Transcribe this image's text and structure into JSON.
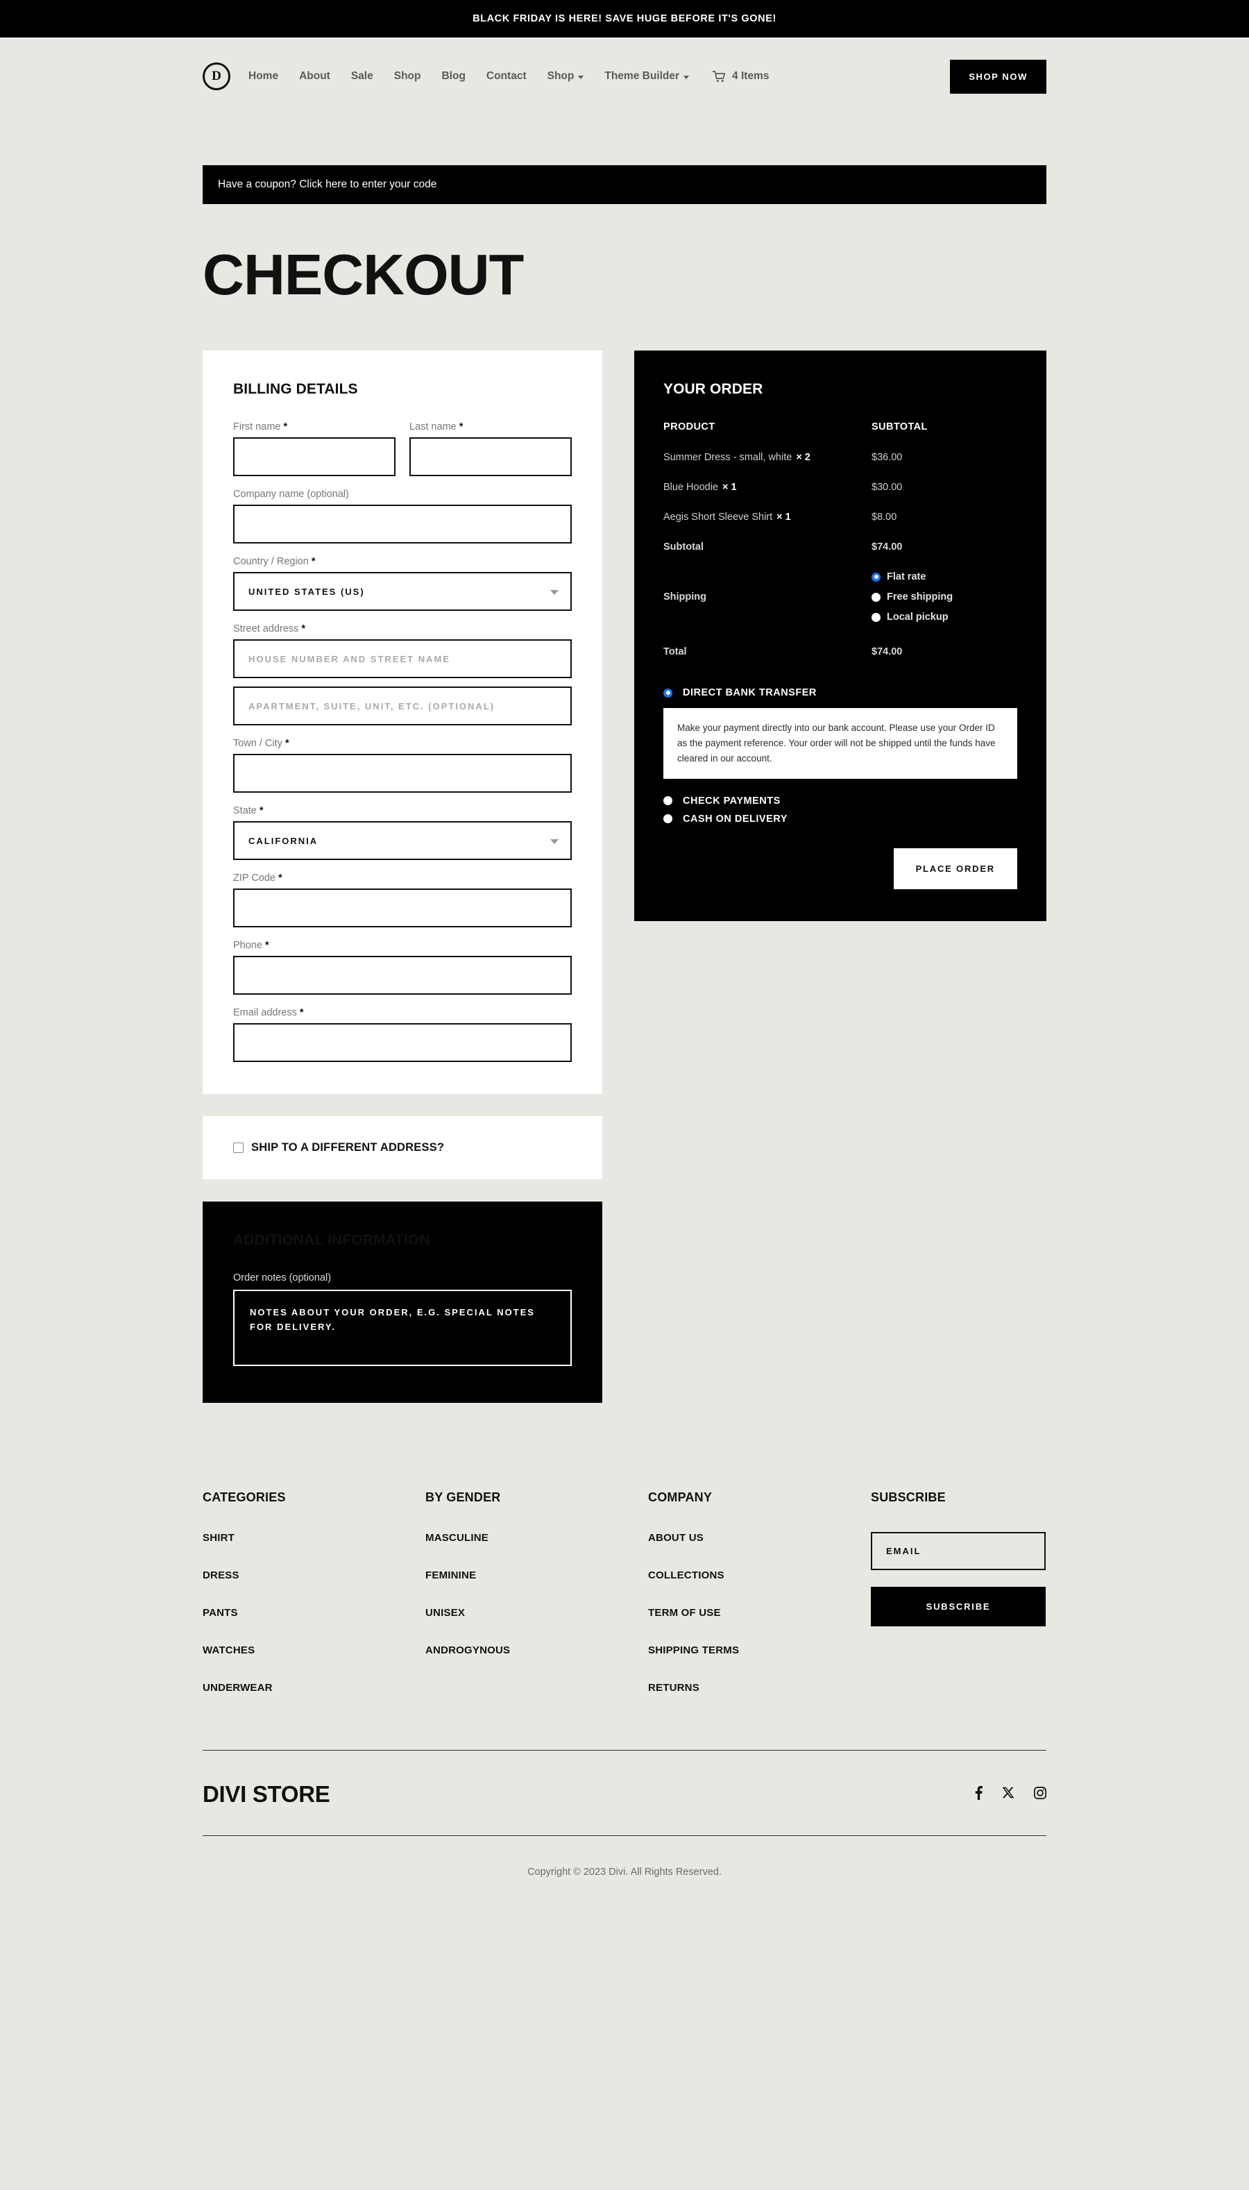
{
  "announcement": {
    "text": "BLACK FRIDAY IS HERE! SAVE HUGE BEFORE IT'S GONE!"
  },
  "header": {
    "logo_letter": "D",
    "nav": [
      {
        "label": "Home",
        "has_caret": false
      },
      {
        "label": "About",
        "has_caret": false
      },
      {
        "label": "Sale",
        "has_caret": false
      },
      {
        "label": "Shop",
        "has_caret": false
      },
      {
        "label": "Blog",
        "has_caret": false
      },
      {
        "label": "Contact",
        "has_caret": false
      },
      {
        "label": "Shop",
        "has_caret": true
      },
      {
        "label": "Theme Builder",
        "has_caret": true
      }
    ],
    "cart_label": "4 Items",
    "cta_label": "SHOP NOW"
  },
  "coupon": {
    "text": "Have a coupon? Click here to enter your code"
  },
  "page_title": "CHECKOUT",
  "billing": {
    "title": "BILLING DETAILS",
    "first_name_label": "First name",
    "last_name_label": "Last name",
    "company_label": "Company name (optional)",
    "country_label": "Country / Region",
    "country_value": "UNITED STATES (US)",
    "street_label": "Street address",
    "street_placeholder": "House number and street name",
    "street2_placeholder": "Apartment, suite, unit, etc. (optional)",
    "city_label": "Town / City",
    "state_label": "State",
    "state_value": "CALIFORNIA",
    "zip_label": "ZIP Code",
    "phone_label": "Phone",
    "email_label": "Email address",
    "required_mark": "*"
  },
  "ship_different": {
    "label": "SHIP TO A DIFFERENT ADDRESS?",
    "checked": false
  },
  "additional": {
    "title": "ADDITIONAL INFORMATION",
    "notes_label": "Order notes (optional)",
    "notes_placeholder": "Notes about your order, e.g. special notes for delivery."
  },
  "order": {
    "title": "YOUR ORDER",
    "col_product": "PRODUCT",
    "col_subtotal": "SUBTOTAL",
    "items": [
      {
        "name": "Summer Dress - small, white",
        "qty": "× 2",
        "price": "$36.00"
      },
      {
        "name": "Blue Hoodie",
        "qty": "× 1",
        "price": "$30.00"
      },
      {
        "name": "Aegis Short Sleeve Shirt",
        "qty": "× 1",
        "price": "$8.00"
      }
    ],
    "subtotal_label": "Subtotal",
    "subtotal_value": "$74.00",
    "shipping_label": "Shipping",
    "shipping_options": [
      {
        "label": "Flat rate",
        "selected": true
      },
      {
        "label": "Free shipping",
        "selected": false
      },
      {
        "label": "Local pickup",
        "selected": false
      }
    ],
    "total_label": "Total",
    "total_value": "$74.00",
    "payment_methods": [
      {
        "label": "DIRECT BANK TRANSFER",
        "selected": true,
        "description": "Make your payment directly into our bank account. Please use your Order ID as the payment reference. Your order will not be shipped until the funds have cleared in our account."
      },
      {
        "label": "CHECK PAYMENTS",
        "selected": false,
        "description": ""
      },
      {
        "label": "CASH ON DELIVERY",
        "selected": false,
        "description": ""
      }
    ],
    "place_order_label": "PLACE ORDER",
    "accent_color": "#1a73e8"
  },
  "footer": {
    "columns": [
      {
        "title": "CATEGORIES",
        "links": [
          "SHIRT",
          "DRESS",
          "PANTS",
          "WATCHES",
          "UNDERWEAR"
        ]
      },
      {
        "title": "BY GENDER",
        "links": [
          "MASCULINE",
          "FEMININE",
          "UNISEX",
          "ANDROGYNOUS"
        ]
      },
      {
        "title": "COMPANY",
        "links": [
          "ABOUT US",
          "COLLECTIONS",
          "TERM OF USE",
          "SHIPPING TERMS",
          "RETURNS"
        ]
      }
    ],
    "subscribe": {
      "title": "SUBSCRIBE",
      "email_placeholder": "Email",
      "button_label": "SUBSCRIBE"
    },
    "brand": "DIVI STORE",
    "socials": [
      "facebook-icon",
      "x-icon",
      "instagram-icon"
    ],
    "copyright": "Copyright © 2023 Divi. All Rights Reserved."
  }
}
